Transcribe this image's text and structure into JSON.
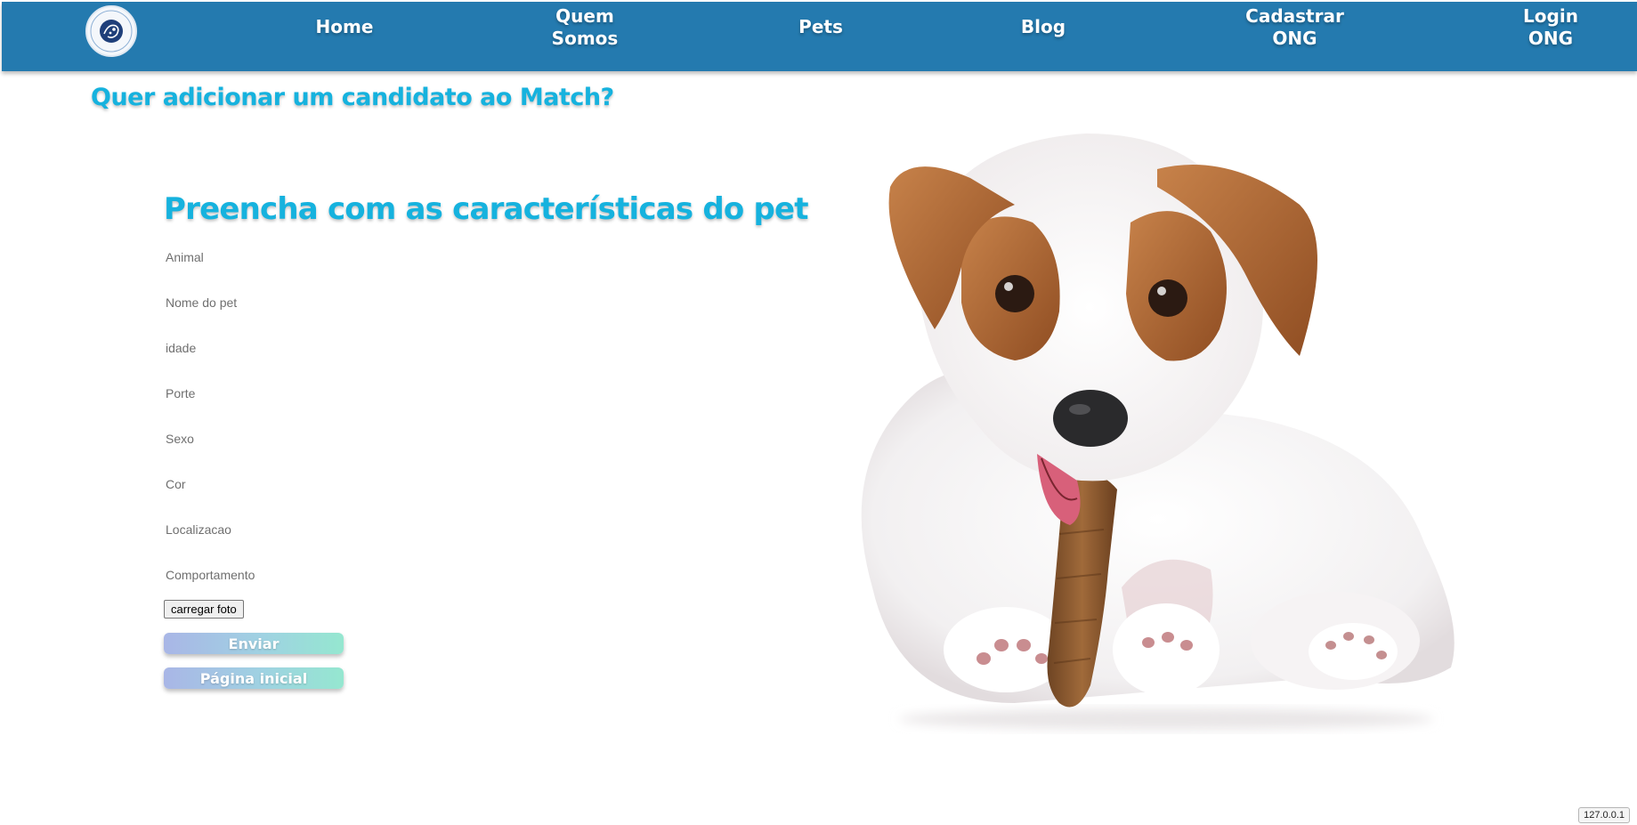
{
  "nav": {
    "items": [
      {
        "label": "Home"
      },
      {
        "label": "Quem\nSomos"
      },
      {
        "label": "Pets"
      },
      {
        "label": "Blog"
      },
      {
        "label": "Cadastrar\nONG"
      },
      {
        "label": "Login\nONG"
      }
    ],
    "logo_icon": "pet-match-logo-icon",
    "bar_color": "#247aaf"
  },
  "header": {
    "question": "Quer adicionar um candidato ao Match?"
  },
  "form": {
    "title": "Preencha com as características do pet",
    "fields": [
      {
        "placeholder": "Animal",
        "value": ""
      },
      {
        "placeholder": "Nome do pet",
        "value": ""
      },
      {
        "placeholder": "idade",
        "value": ""
      },
      {
        "placeholder": "Porte",
        "value": ""
      },
      {
        "placeholder": "Sexo",
        "value": ""
      },
      {
        "placeholder": "Cor",
        "value": ""
      },
      {
        "placeholder": "Localizacao",
        "value": ""
      },
      {
        "placeholder": "Comportamento",
        "value": ""
      }
    ],
    "upload_label": "carregar foto",
    "submit_label": "Enviar",
    "home_label": "Página inicial",
    "accent_color": "#16b2de"
  },
  "image": {
    "subject": "puppy-chewing-bone"
  },
  "status": {
    "host": "127.0.0.1"
  }
}
